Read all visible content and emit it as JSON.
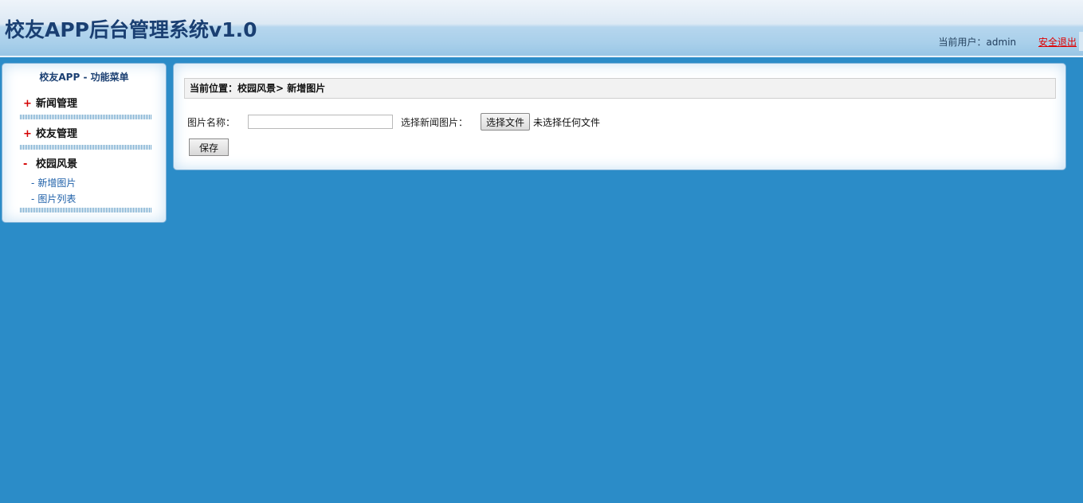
{
  "header": {
    "app_title": "校友APP后台管理系统v1.0",
    "current_user_label": "当前用户：",
    "current_user": "admin",
    "logout_label": "安全退出"
  },
  "sidebar": {
    "title": "校友APP - 功能菜单",
    "groups": [
      {
        "sign": "+",
        "label": "新闻管理",
        "expanded": false
      },
      {
        "sign": "+",
        "label": "校友管理",
        "expanded": false
      },
      {
        "sign": "-",
        "label": "校园风景",
        "expanded": true,
        "items": [
          {
            "dash": "-",
            "label": "新增图片"
          },
          {
            "dash": "-",
            "label": "图片列表"
          }
        ]
      }
    ]
  },
  "main": {
    "breadcrumb": "当前位置：校园风景> 新增图片",
    "form": {
      "name_label": "图片名称：",
      "name_value": "",
      "image_label": "选择新闻图片：",
      "choose_file_label": "选择文件",
      "no_file_text": "未选择任何文件",
      "save_label": "保存"
    }
  },
  "colors": {
    "background": "#2b8cc8",
    "title": "#1a3f72",
    "logout": "#e00000",
    "menu_sign": "#d40000",
    "sub_item": "#1d5fa8"
  }
}
